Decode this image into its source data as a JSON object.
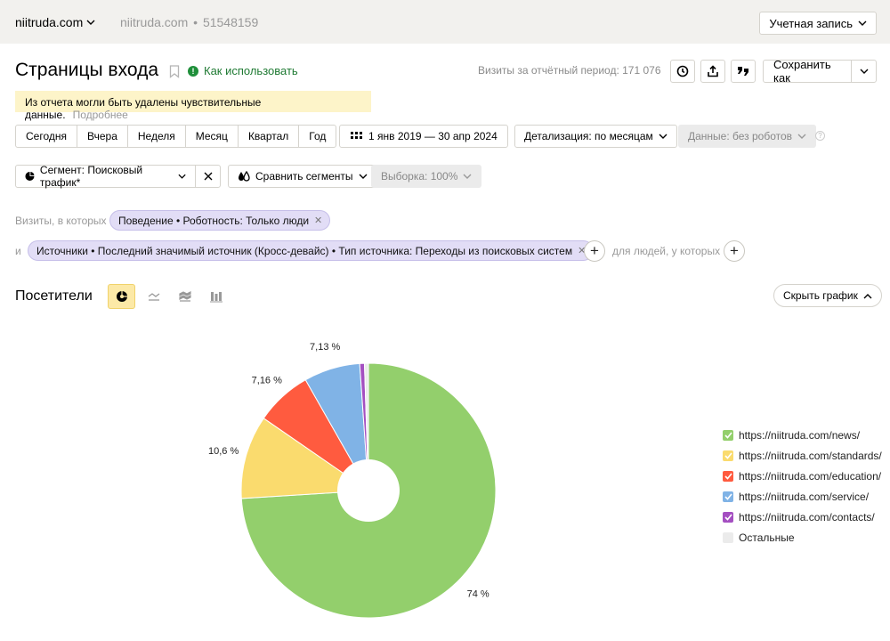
{
  "topbar": {
    "site_name": "niitruda.com",
    "site_alias": "niitruda.com",
    "counter_id": "51548159",
    "account_label": "Учетная запись"
  },
  "header": {
    "title": "Страницы входа",
    "howto_label": "Как использовать",
    "visits_total": "Визиты за отчётный период: 171 076",
    "save_label": "Сохранить как"
  },
  "notice": {
    "text": "Из отчета могли быть удалены чувствительные данные.",
    "more": "Подробнее"
  },
  "periods": [
    "Сегодня",
    "Вчера",
    "Неделя",
    "Месяц",
    "Квартал",
    "Год"
  ],
  "date_range": "1 янв 2019 — 30 апр 2024",
  "detail_label": "Детализация: по месяцам",
  "robots_label": "Данные: без роботов",
  "segment_label": "Сегмент: Поисковый трафик*",
  "compare_label": "Сравнить сегменты",
  "sample_label": "Выборка: 100%",
  "filters": {
    "visits_label": "Визиты, в которых",
    "chip1": "Поведение • Роботность: Только люди",
    "and_label": "и",
    "chip2": "Источники • Последний значимый источник (Кросс-девайс) • Тип источника: Переходы из поисковых систем",
    "people_label": "для людей, у которых"
  },
  "chart_section": {
    "title": "Посетители",
    "hide_label": "Скрыть график"
  },
  "chart_data": {
    "type": "pie",
    "title": "",
    "donut": true,
    "slices": [
      {
        "label": "https://niitruda.com/news/",
        "value": 74,
        "display": "74 %",
        "color": "#93cf6c"
      },
      {
        "label": "https://niitruda.com/standards/",
        "value": 10.6,
        "display": "10,6 %",
        "color": "#fadb6e"
      },
      {
        "label": "https://niitruda.com/education/",
        "value": 7.16,
        "display": "7,16 %",
        "color": "#ff5b3f"
      },
      {
        "label": "https://niitruda.com/service/",
        "value": 7.13,
        "display": "7,13 %",
        "color": "#80b3e6"
      },
      {
        "label": "https://niitruda.com/contacts/",
        "value": 0.6,
        "display": "",
        "color": "#a44fc1"
      },
      {
        "label": "Остальные",
        "value": 0.5,
        "display": "",
        "color": "#ebebeb"
      }
    ],
    "legend_position": "right"
  }
}
